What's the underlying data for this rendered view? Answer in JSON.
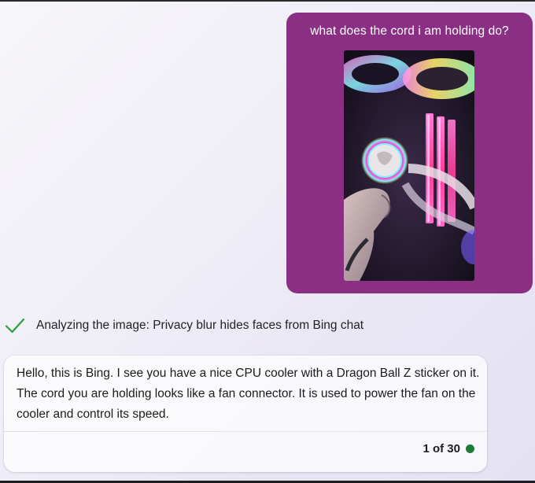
{
  "user_message": {
    "text": "what does the cord i am holding do?",
    "attachment_icon": "photo-of-cpu-cooler-with-rgb-fans"
  },
  "status": {
    "icon": "checkmark-icon",
    "text": "Analyzing the image: Privacy blur hides faces from Bing chat"
  },
  "bot_message": {
    "text": "Hello, this is Bing. I see you have a nice CPU cooler with a Dragon Ball Z sticker on it. The cord you are holding looks like a fan connector. It is used to power the fan on the cooler and control its speed.",
    "counter": "1 of 30"
  },
  "colors": {
    "user_bubble": "#8a2f84",
    "check": "#2e9e3a",
    "status_dot": "#1f7a3a"
  }
}
